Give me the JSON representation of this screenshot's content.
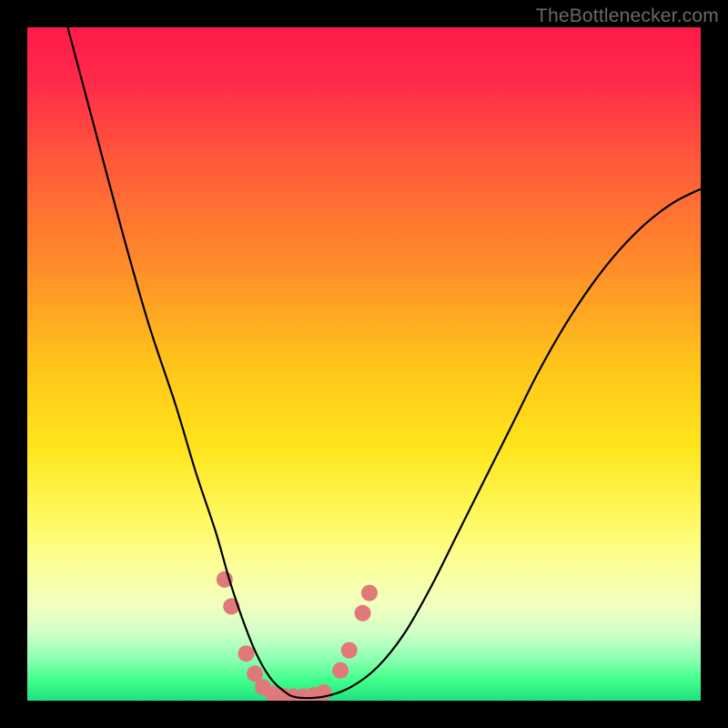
{
  "watermark": "TheBottlenecker.com",
  "chart_data": {
    "type": "line",
    "title": "",
    "xlabel": "",
    "ylabel": "",
    "xlim": [
      0,
      100
    ],
    "ylim": [
      0,
      100
    ],
    "grid": false,
    "legend": false,
    "gradient_stops": [
      {
        "offset": 0.0,
        "color": "#ff1a4a"
      },
      {
        "offset": 0.08,
        "color": "#ff2a4a"
      },
      {
        "offset": 0.2,
        "color": "#ff5a3a"
      },
      {
        "offset": 0.35,
        "color": "#ff8b2a"
      },
      {
        "offset": 0.5,
        "color": "#ffc41a"
      },
      {
        "offset": 0.62,
        "color": "#ffe41a"
      },
      {
        "offset": 0.72,
        "color": "#fff85a"
      },
      {
        "offset": 0.8,
        "color": "#fcff9a"
      },
      {
        "offset": 0.86,
        "color": "#f0ffc0"
      },
      {
        "offset": 0.9,
        "color": "#d0ffc8"
      },
      {
        "offset": 0.94,
        "color": "#88ffb0"
      },
      {
        "offset": 0.97,
        "color": "#40ff8a"
      },
      {
        "offset": 1.0,
        "color": "#20e080"
      }
    ],
    "series": [
      {
        "name": "bottleneck-curve",
        "color": "#000000",
        "x": [
          6,
          10,
          14,
          18,
          22,
          25,
          28,
          30,
          32,
          34,
          36,
          38,
          40,
          44,
          48,
          52,
          56,
          60,
          64,
          68,
          72,
          76,
          80,
          84,
          88,
          92,
          96,
          100
        ],
        "y": [
          100,
          85,
          70,
          56,
          44,
          34,
          25,
          18,
          12,
          7,
          3.5,
          1.5,
          0.5,
          0.6,
          2,
          5,
          10,
          17,
          25,
          33,
          41,
          49,
          56,
          62,
          67,
          71,
          74,
          76
        ]
      }
    ],
    "markers": {
      "name": "highlight-points",
      "color": "#e07a7a",
      "radius": 9,
      "points": [
        {
          "x": 29.3,
          "y": 18
        },
        {
          "x": 30.3,
          "y": 14
        },
        {
          "x": 32.5,
          "y": 7
        },
        {
          "x": 33.8,
          "y": 4
        },
        {
          "x": 35.0,
          "y": 2
        },
        {
          "x": 36.5,
          "y": 1
        },
        {
          "x": 38.0,
          "y": 0.7
        },
        {
          "x": 39.5,
          "y": 0.6
        },
        {
          "x": 41.0,
          "y": 0.6
        },
        {
          "x": 42.5,
          "y": 0.8
        },
        {
          "x": 44.0,
          "y": 1.2
        },
        {
          "x": 46.5,
          "y": 4.5
        },
        {
          "x": 47.8,
          "y": 7.5
        },
        {
          "x": 49.8,
          "y": 13
        },
        {
          "x": 50.8,
          "y": 16
        }
      ]
    }
  }
}
